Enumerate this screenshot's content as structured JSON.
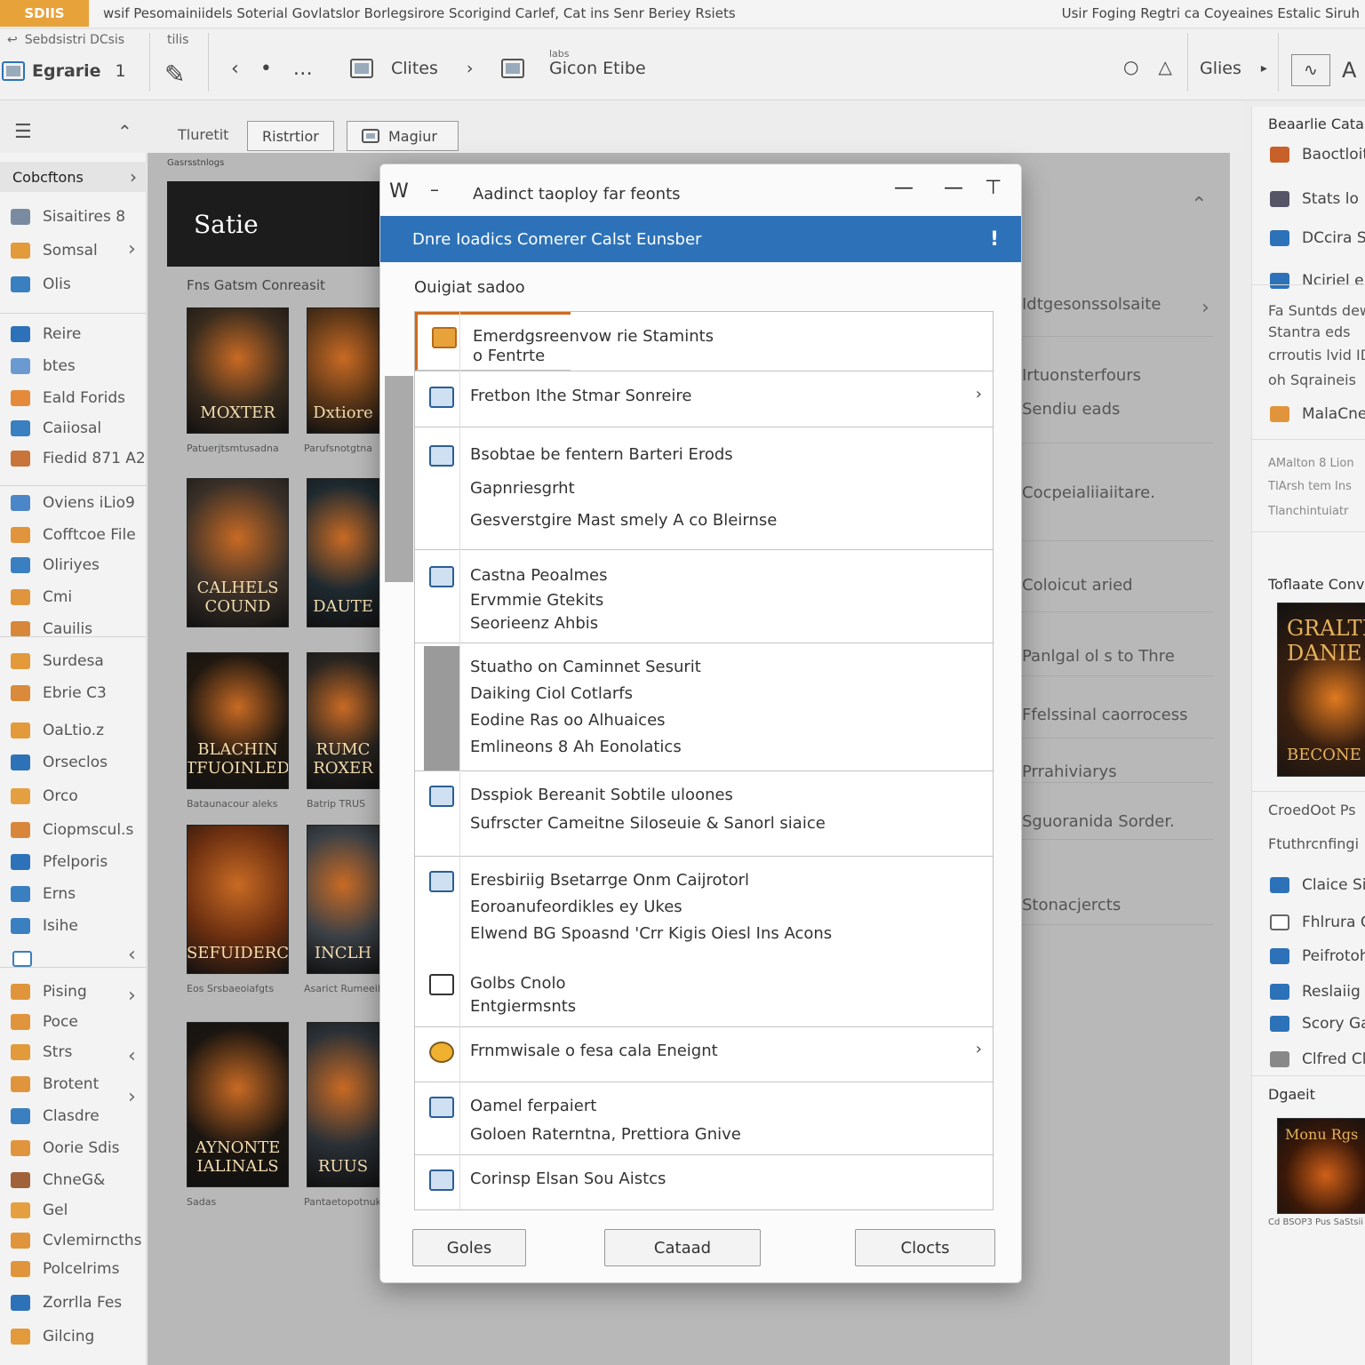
{
  "menubar": {
    "brand": "SDIIS",
    "left_text": "wsif Pesomainiidels   Soterial  Govlatslor  Borlegsirore  Scorigind  Carlef,  Cat ins  Senr Beriey  Rsiets",
    "right_text": "Usir Foging  Regtri ca  Coyeaines  Estalic  Siruh"
  },
  "toolbar": {
    "crumb": "Sebdsistri DCsis",
    "crumb2": "tilis",
    "app_label": "Egrarie",
    "app_num": "1",
    "cites_label": "Clites",
    "doc_label": "Gicon Etibe",
    "doc_sub": "labs",
    "glies_label": "Glies"
  },
  "subbar": {
    "tab1": "Tluretit",
    "tab2": "Ristrtior",
    "tab3": "Magiur"
  },
  "sidebar": {
    "header": "Cobcftons",
    "items": [
      {
        "label": "Sisaitires 8",
        "color": "#7a8aa0"
      },
      {
        "label": "Somsal",
        "color": "#e29a3a"
      },
      {
        "label": "Olis",
        "color": "#3a7fc0"
      },
      {
        "label": "Reire",
        "color": "#2d72b8"
      },
      {
        "label": "btes",
        "color": "#6a9ad0"
      },
      {
        "label": "Eald Forids",
        "color": "#e48a3a"
      },
      {
        "label": "Caiiosal",
        "color": "#3a7fc0"
      },
      {
        "label": "Fiedid 871 A2",
        "color": "#c8743a"
      },
      {
        "label": "Oviens iLio9",
        "color": "#4a86c8"
      },
      {
        "label": "Cofftcoe File",
        "color": "#e0953c"
      },
      {
        "label": "Oliriyes",
        "color": "#3a7fc0"
      },
      {
        "label": "Cmi",
        "color": "#e0953c"
      },
      {
        "label": "Cauilis",
        "color": "#d8873a"
      },
      {
        "label": "Surdesa",
        "color": "#e29a3a"
      },
      {
        "label": "Ebrie C3",
        "color": "#d98a3a"
      },
      {
        "label": "OaLtio.z",
        "color": "#e29a3a"
      },
      {
        "label": "Orseclos",
        "color": "#2d72b8"
      },
      {
        "label": "Orco",
        "color": "#e4a040"
      },
      {
        "label": "Ciopmscul.s",
        "color": "#d8873a"
      },
      {
        "label": "Pfelporis",
        "color": "#2d72b8"
      },
      {
        "label": "Erns",
        "color": "#3a7fc0"
      },
      {
        "label": "Isihe",
        "color": "#3a7fc0"
      },
      {
        "label": "Pising",
        "color": "#e0953c"
      },
      {
        "label": "Poce",
        "color": "#e0953c"
      },
      {
        "label": "Strs",
        "color": "#e29a3a"
      },
      {
        "label": "Brotent",
        "color": "#e0953c"
      },
      {
        "label": "Clasdre",
        "color": "#3a7fc0"
      },
      {
        "label": "Oorie Sdis",
        "color": "#e0953c"
      },
      {
        "label": "ChneG&",
        "color": "#a0623a"
      },
      {
        "label": "Gel",
        "color": "#e4a040"
      },
      {
        "label": "Cvlemirncths",
        "color": "#e0953c"
      },
      {
        "label": "Polcelrims",
        "color": "#e0953c"
      },
      {
        "label": "Zorrlla Fes",
        "color": "#2d72b8"
      },
      {
        "label": "Gilcing",
        "color": "#e29a3a"
      }
    ]
  },
  "content": {
    "breadcrumb": "Gasrsstnlogs",
    "header": "Satie",
    "section": "Fns Gatsm Conreasit",
    "covers": [
      {
        "title": "MOXTER",
        "caption": "Patuerjtsmtusadna",
        "bg": "#3a2c1e"
      },
      {
        "title": "Dxtiore",
        "caption": "Parufsnotgtna",
        "bg": "#5a3618"
      },
      {
        "title": "CALHELS COUND",
        "caption": "",
        "bg": "#3a3028"
      },
      {
        "title": "DAUTE",
        "caption": "",
        "bg": "#1e2a30"
      },
      {
        "title": "BLACHIN TFUOINLED",
        "caption": "Bataunacour aleks",
        "bg": "#201810"
      },
      {
        "title": "RUMC ROXER",
        "caption": "Batrip TRUS",
        "bg": "#282420"
      },
      {
        "title": "SEFUIDERC",
        "caption": "Eos Srsbaeoiafgts",
        "bg": "#6a2e10"
      },
      {
        "title": "INCLH",
        "caption": "Asarict Rumeeils",
        "bg": "#3a4046"
      },
      {
        "title": "AYNONTE IALINALS",
        "caption": "Sadas",
        "bg": "#1a1510"
      },
      {
        "title": "RUUS",
        "caption": "Pantaetopotnuk",
        "bg": "#2a3036"
      }
    ],
    "behind": [
      "Idtgesonssolsaite",
      "Irtuonsterfours",
      "Sendiu eads",
      "Cocpeialiiaiitare.",
      "Coloicut aried",
      "Panlgal ol s to Thre",
      "Ffelssinal caorrocess",
      "Prrahiviarys",
      "Sguoranida Sorder.",
      "Stonacjercts"
    ]
  },
  "dialog": {
    "title_letter": "W",
    "title": "Aadinct taoploy far feonts",
    "header": "Dnre Ioadics Comerer Calst Eunsber",
    "header_icon": "!",
    "subtitle": "Ouigiat sadoo",
    "groups": [
      {
        "lines": [
          "Emerdgsreenvow rie Stamints",
          "o Fentrte"
        ]
      },
      {
        "lines": [
          "Fretbon Ithe Stmar Sonreire"
        ],
        "chev": "›"
      },
      {
        "lines": [
          "Bsobtae be fentern Barteri Erods",
          "Gapnriesgrht",
          "Gesverstgire Mast smely A co Bleirnse"
        ]
      },
      {
        "lines": [
          "Castna Peoalmes",
          "Ervmmie Gtekits",
          "Seorieenz Ahbis"
        ]
      },
      {
        "lines": [
          "Stuatho on Caminnet Sesurit",
          "Daiking Ciol Cotlarfs",
          "Eodine Ras oo Alhuaices",
          "Emlineons 8 Ah Eonolatics"
        ]
      },
      {
        "lines": [
          "Dsspiok Bereanit Sobtile uloones",
          "Sufrscter Cameitne Siloseuie & Sanorl siaice"
        ]
      },
      {
        "lines": [
          "Eresbiriig Bsetarrge Onm Caijrotorl",
          "Eoroanufeordikles ey Ukes",
          "Elwend BG Spoasnd 'Crr Kigis Oiesl Ins Acons"
        ]
      },
      {
        "lines": [
          "Golbs Cnolo",
          "Entgiermsnts"
        ]
      },
      {
        "lines": [
          "Frnmwisale o fesa cala Eneignt"
        ],
        "chev": "›"
      },
      {
        "lines": [
          "Oamel ferpaiert",
          "Goloen Raterntna, Prettiora Gnive"
        ]
      },
      {
        "lines": [
          "Corinsp Elsan Sou Aistcs"
        ]
      }
    ],
    "buttons": {
      "b1": "Goles",
      "b2": "Cataad",
      "b3": "Clocts"
    }
  },
  "right_panel": {
    "header": "Beaarlie Catalog",
    "items": [
      "Baoctloit",
      "Stats lo",
      "DCcira S",
      "Nciriel el"
    ],
    "para": [
      "Fa Suntds dew",
      "Stantra eds",
      "crroutis lvid ID",
      "oh Sqraineis"
    ],
    "item5": "MalaCnes",
    "small": [
      "AMalton 8 Lion",
      "TIArsh tem Ins",
      "Tlanchintuiatr"
    ],
    "section2": "Toflaate Conv",
    "cover_title": "GRALTI DANIE",
    "cover_sub": "BECONE",
    "text2": "CroedOot  Ps",
    "text3": "Ftuthrcnfingi",
    "items2": [
      "Claice Si",
      "Fhlrura Cl",
      "Peifrotoh",
      "Reslaiig",
      "Scory Gat",
      "Clfred Cl"
    ],
    "section3": "Dgaeit",
    "cover2_title": "Monu Rgs",
    "cover2_cap": "Cd BSOP3 Pus SaStsii"
  },
  "colors": {
    "accent": "#2d72b8",
    "brand": "#e8a23a"
  }
}
